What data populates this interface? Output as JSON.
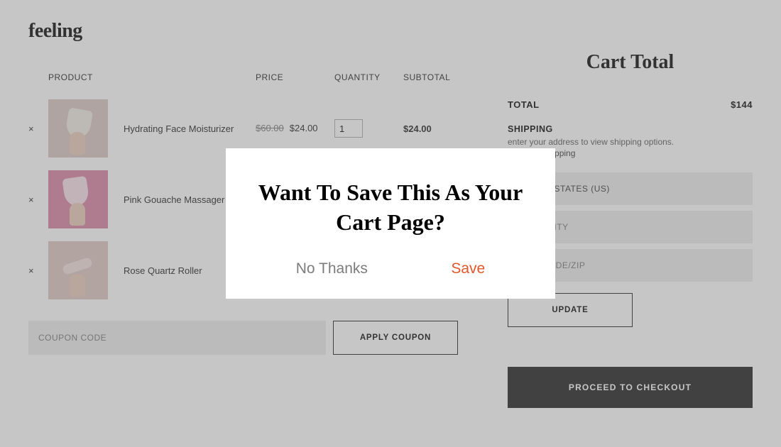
{
  "logo": "feeling",
  "headers": {
    "product": "PRODUCT",
    "price": "PRICE",
    "quantity": "QUANTITY",
    "subtotal": "SUBTOTAL"
  },
  "items": [
    {
      "name": "Hydrating Face Moisturizer",
      "old_price": "$60.00",
      "price": "$24.00",
      "qty": "1",
      "subtotal": "$24.00"
    },
    {
      "name": "Pink Gouache Massager",
      "old_price": "",
      "price": "",
      "qty": "",
      "subtotal": ""
    },
    {
      "name": "Rose Quartz Roller",
      "old_price": "",
      "price": "",
      "qty": "",
      "subtotal": ""
    }
  ],
  "coupon": {
    "placeholder": "COUPON CODE",
    "apply": "APPLY COUPON"
  },
  "cart": {
    "title": "Cart Total",
    "total_label": "TOTAL",
    "total_value": "$144",
    "shipping_label": "SHIPPING",
    "shipping_desc": "enter your address to view shipping options.",
    "shipping_link": "calculate shipping",
    "country": "UNITED STATES (US)",
    "city_placeholder": "TOWN/CITY",
    "zip_placeholder": "POSTCODE/ZIP",
    "update": "UPDATE",
    "checkout": "PROCEED TO CHECKOUT"
  },
  "modal": {
    "title": "Want To Save This As Your Cart Page?",
    "no": "No Thanks",
    "save": "Save"
  }
}
